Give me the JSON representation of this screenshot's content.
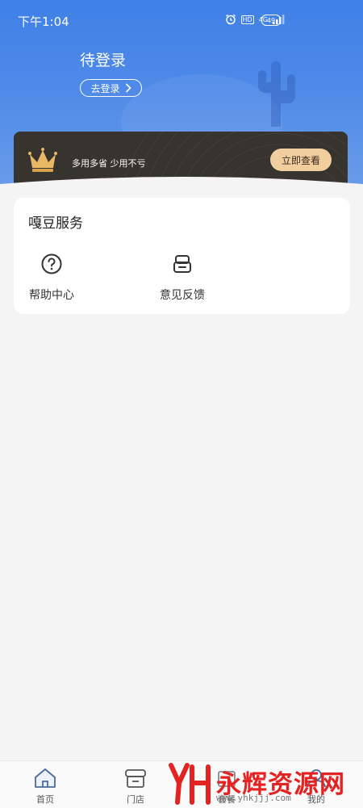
{
  "status_bar": {
    "time": "下午1:04",
    "hd": "HD",
    "network": "4G",
    "battery": "49"
  },
  "header": {
    "title": "待登录",
    "login_button": "去登录"
  },
  "vip_banner": {
    "slogan": "多用多省 少用不亏",
    "button": "立即查看"
  },
  "services": {
    "title": "嘎豆服务",
    "items": [
      {
        "label": "帮助中心",
        "icon": "help-circle-icon"
      },
      {
        "label": "意见反馈",
        "icon": "feedback-icon"
      }
    ]
  },
  "tab_bar": {
    "items": [
      {
        "label": "首页",
        "icon": "home-icon"
      },
      {
        "label": "门店",
        "icon": "store-icon"
      },
      {
        "label": "套餐",
        "icon": "package-icon"
      },
      {
        "label": "我的",
        "icon": "profile-icon"
      }
    ]
  },
  "watermark": {
    "text": "永辉资源网",
    "url": "www.yhkjjj.com"
  },
  "colors": {
    "header_blue": "#3f7fe6",
    "vip_dark": "#37332f",
    "vip_gold": "#f1ce9d",
    "watermark_red": "#e52222"
  }
}
